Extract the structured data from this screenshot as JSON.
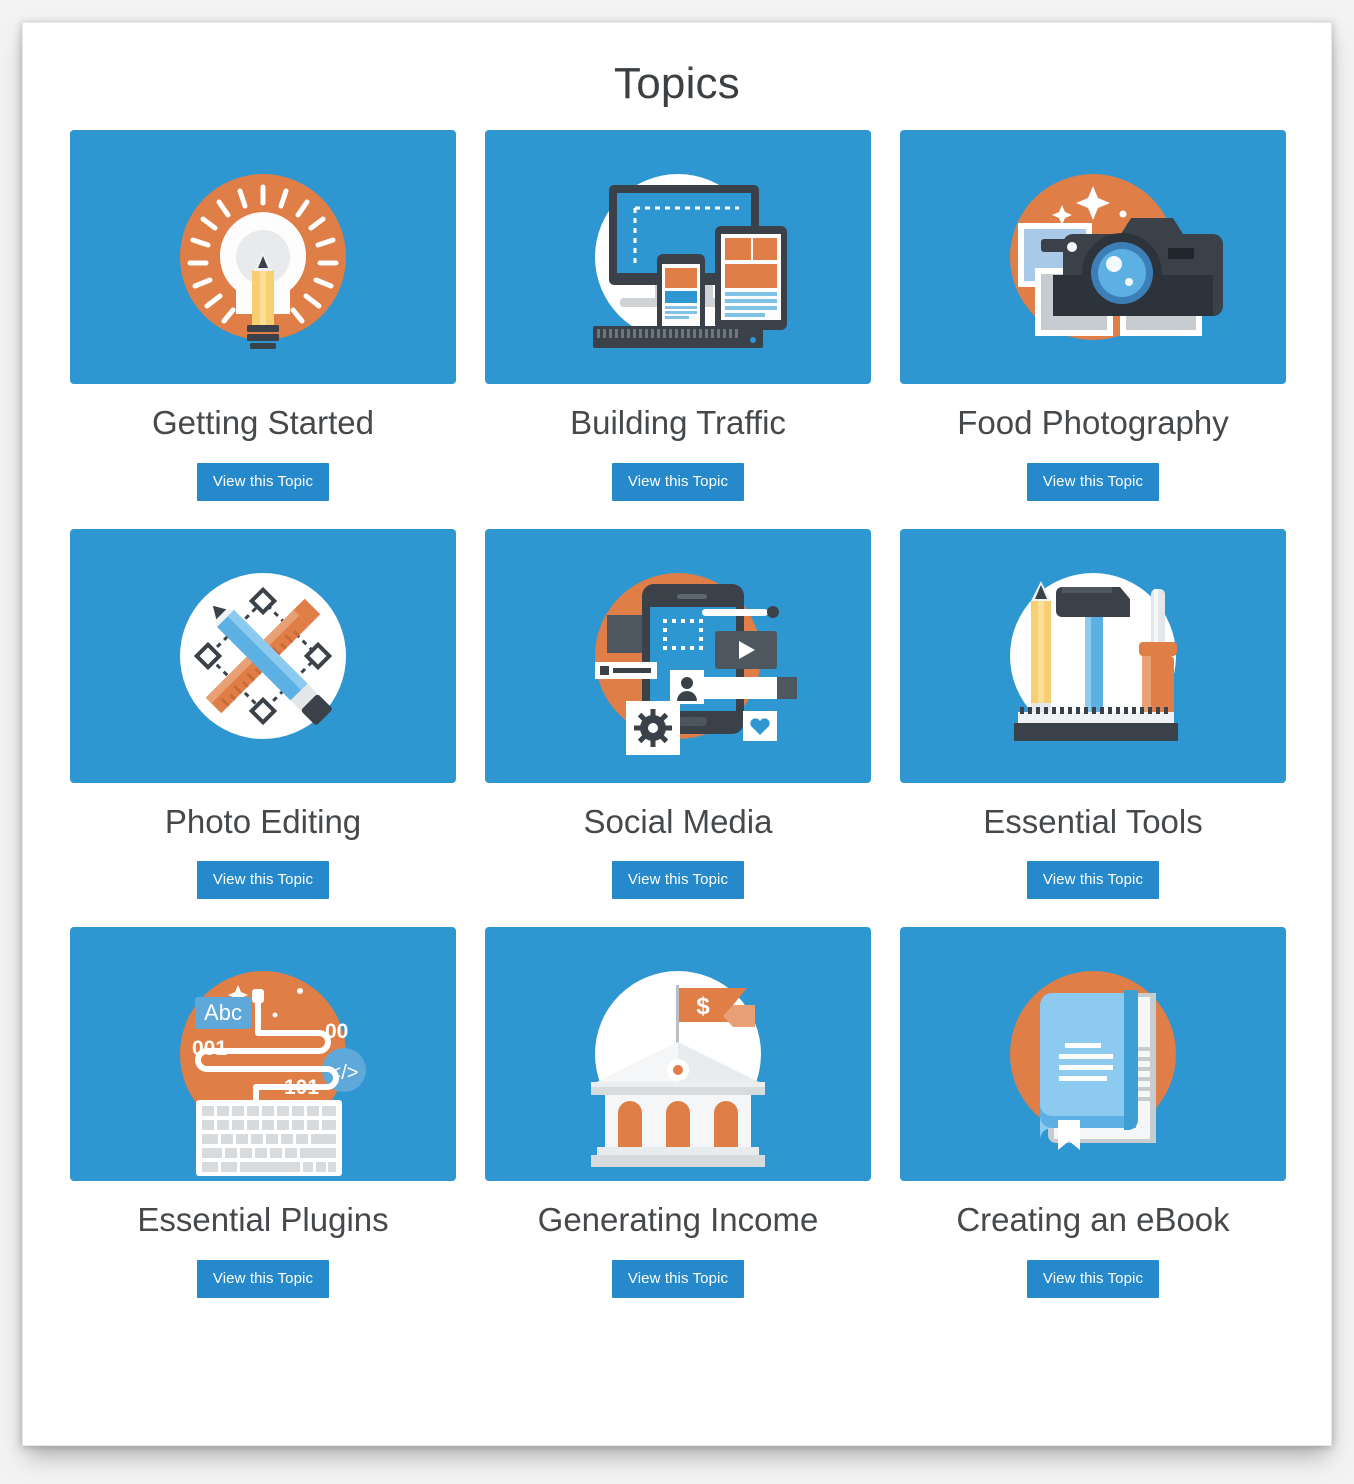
{
  "page": {
    "title": "Topics",
    "background_color": "#f3f3f3",
    "panel_color": "#ffffff",
    "accent_blue": "#2e96d1",
    "button_blue": "#2689cb",
    "accent_orange": "#df7e46",
    "label_color": "#46494c"
  },
  "topics": [
    {
      "label": "Getting Started",
      "button_label": "View this Topic",
      "icon": "lightbulb-pencil-icon",
      "icon_circle_color": "#df7e46"
    },
    {
      "label": "Building Traffic",
      "button_label": "View this Topic",
      "icon": "responsive-devices-icon",
      "icon_circle_color": "#ffffff"
    },
    {
      "label": "Food Photography",
      "button_label": "View this Topic",
      "icon": "camera-photos-icon",
      "icon_circle_color": "#df7e46"
    },
    {
      "label": "Photo Editing",
      "button_label": "View this Topic",
      "icon": "pencil-ruler-icon",
      "icon_circle_color": "#ffffff"
    },
    {
      "label": "Social Media",
      "button_label": "View this Topic",
      "icon": "smartphone-social-icon",
      "icon_circle_color": "#df7e46"
    },
    {
      "label": "Essential Tools",
      "button_label": "View this Topic",
      "icon": "hammer-screwdriver-pencil-icon",
      "icon_circle_color": "#ffffff"
    },
    {
      "label": "Essential Plugins",
      "button_label": "View this Topic",
      "icon": "keyboard-code-icon",
      "icon_circle_color": "#df7e46",
      "icon_text": {
        "abc": "Abc",
        "binary_left": "001",
        "binary_top": "00",
        "binary_mid": "101",
        "code_tag": "</>"
      }
    },
    {
      "label": "Generating Income",
      "button_label": "View this Topic",
      "icon": "bank-dollar-flag-icon",
      "icon_circle_color": "#ffffff",
      "icon_text": {
        "currency": "$"
      }
    },
    {
      "label": "Creating an eBook",
      "button_label": "View this Topic",
      "icon": "book-bookmark-icon",
      "icon_circle_color": "#df7e46"
    }
  ]
}
